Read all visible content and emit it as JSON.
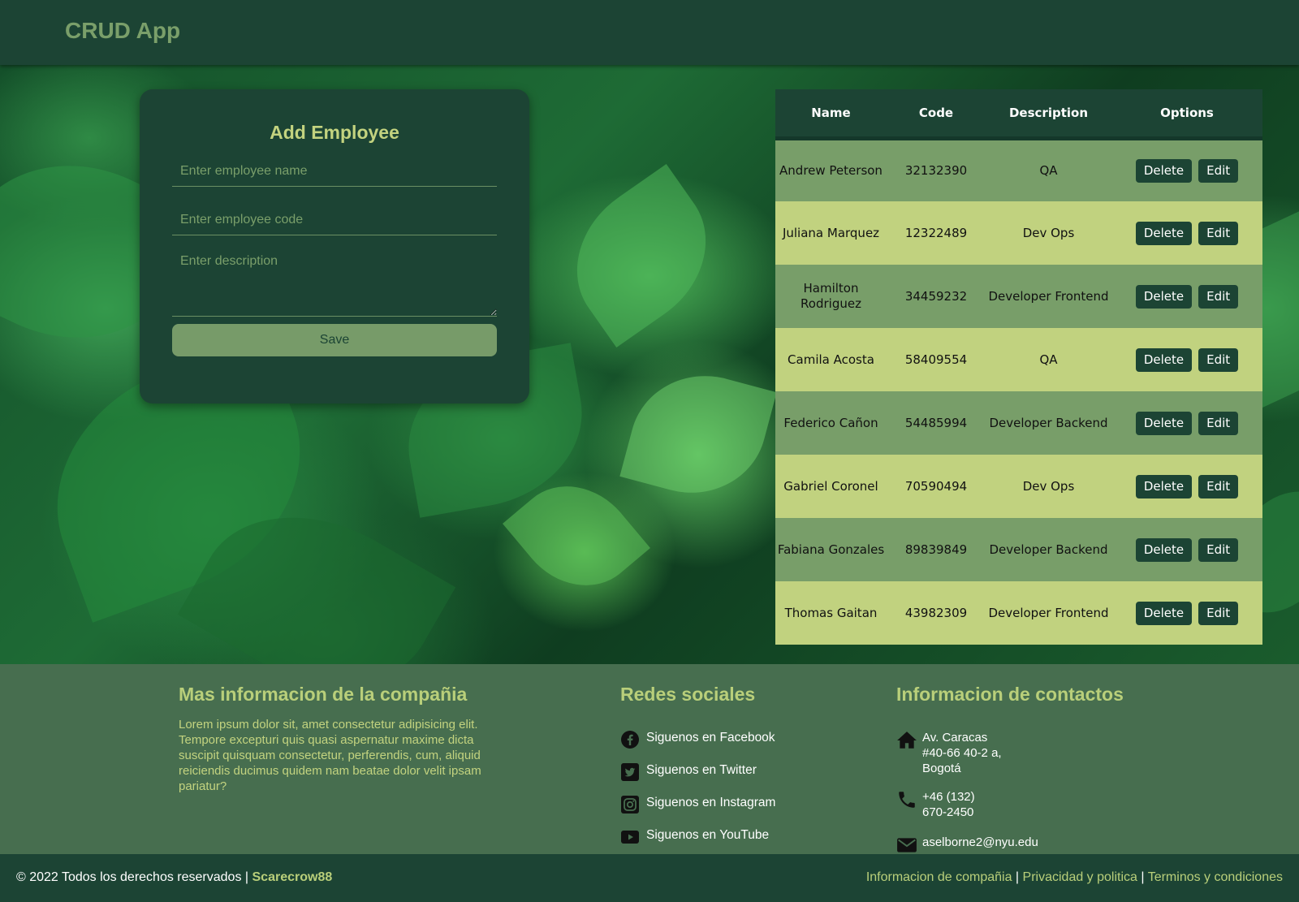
{
  "header": {
    "brand": "CRUD App"
  },
  "form": {
    "title": "Add Employee",
    "name_placeholder": "Enter employee name",
    "code_placeholder": "Enter employee code",
    "description_placeholder": "Enter description",
    "save_label": "Save"
  },
  "table": {
    "headers": [
      "Name",
      "Code",
      "Description",
      "Options"
    ],
    "delete_label": "Delete",
    "edit_label": "Edit",
    "rows": [
      {
        "name": "Andrew Peterson",
        "code": "32132390",
        "description": "QA"
      },
      {
        "name": "Juliana Marquez",
        "code": "12322489",
        "description": "Dev Ops"
      },
      {
        "name": "Hamilton Rodriguez",
        "code": "34459232",
        "description": "Developer Frontend"
      },
      {
        "name": "Camila Acosta",
        "code": "58409554",
        "description": "QA"
      },
      {
        "name": "Federico Cañon",
        "code": "54485994",
        "description": "Developer Backend"
      },
      {
        "name": "Gabriel Coronel",
        "code": "70590494",
        "description": "Dev Ops"
      },
      {
        "name": "Fabiana Gonzales",
        "code": "89839849",
        "description": "Developer Backend"
      },
      {
        "name": "Thomas Gaitan",
        "code": "43982309",
        "description": "Developer Frontend"
      }
    ]
  },
  "footer": {
    "about": {
      "title": "Mas informacion de la compañia",
      "text": "Lorem ipsum dolor sit, amet consectetur adipisicing elit. Tempore excepturi quis quasi aspernatur maxime dicta suscipit quisquam consectetur, perferendis, cum, aliquid reiciendis ducimus quidem nam beatae dolor velit ipsam pariatur?"
    },
    "social": {
      "title": "Redes sociales",
      "items": [
        {
          "icon": "facebook-icon",
          "label": "Siguenos en Facebook"
        },
        {
          "icon": "twitter-icon",
          "label": "Siguenos en Twitter"
        },
        {
          "icon": "instagram-icon",
          "label": "Siguenos en Instagram"
        },
        {
          "icon": "youtube-icon",
          "label": "Siguenos en YouTube"
        }
      ]
    },
    "contact": {
      "title": "Informacion de contactos",
      "address": "Av. Caracas #40-66 40-2 a, Bogotá",
      "phone": "+46 (132) 670-2450",
      "email": "aselborne2@nyu.edu"
    }
  },
  "bottombar": {
    "copyright": "© 2022 Todos los derechos reservados |",
    "author": "Scarecrow88",
    "links": [
      "Informacion de compañia",
      "Privacidad y politica",
      "Terminos y condiciones"
    ],
    "separator": "|"
  },
  "colors": {
    "primary_dark": "#1c4434",
    "accent": "#c3d37f",
    "row_odd": "#789e69",
    "row_even": "#c1d27f",
    "footer_bg": "#476e4f"
  }
}
